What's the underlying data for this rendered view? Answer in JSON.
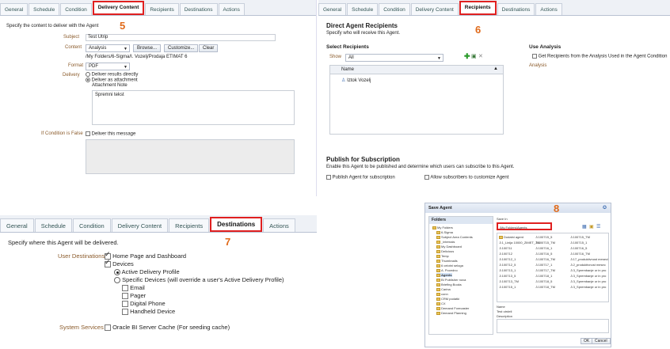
{
  "tabs": [
    "General",
    "Schedule",
    "Condition",
    "Delivery Content",
    "Recipients",
    "Destinations",
    "Actions"
  ],
  "steps": {
    "s5": "5",
    "s6": "6",
    "s7": "7",
    "s8": "8"
  },
  "delivery": {
    "intro": "Specify the content to deliver with the Agent",
    "subject_label": "Subject",
    "subject_value": "Test Utrip",
    "content_label": "Content",
    "content_value": "Analysis",
    "browse": "Browse...",
    "customize": "Customize...",
    "clear": "Clear",
    "path": "/My Folders/6-Sigma/I. Vozelj/Prodaja ETIMAT 6",
    "format_label": "Format",
    "format_value": "PDF",
    "delivery_label": "Delivery",
    "opt_direct": "Deliver results directly",
    "opt_attach": "Deliver as attachment",
    "note_label": "Attachment Note",
    "note_value": "Spremni tekst",
    "false_label": "If Condition is False",
    "false_value": "Deliver this message"
  },
  "recipients": {
    "title": "Direct Agent Recipients",
    "sub": "Specify who will receive this Agent.",
    "select_title": "Select Recipients",
    "show_label": "Show",
    "show_value": "All",
    "col_name": "Name",
    "recipient": "Iztok Vozelj",
    "use_title": "Use Analysis",
    "use_opt": "Get Recipients from the Analysis Used in the Agent Condition",
    "analysis": "Analysis",
    "pub_title": "Publish for Subscription",
    "pub_sub": "Enable this Agent to be published and determine which users can subscribe to this Agent.",
    "pub_opt": "Publish Agent for subscription",
    "allow_opt": "Allow subscribers to customize Agent"
  },
  "destinations": {
    "intro": "Specify where this Agent will be delivered.",
    "user_label": "User Destinations",
    "home": "Home Page and Dashboard",
    "devices": "Devices",
    "active": "Active Delivery Profile",
    "specific": "Specific Devices (will override a user's Active Delivery Profile)",
    "email": "Email",
    "pager": "Pager",
    "phone": "Digital Phone",
    "handheld": "Handheld Device",
    "system_label": "System Services",
    "cache": "Oracle BI Server Cache (For seeding cache)"
  },
  "save": {
    "title": "Save Agent",
    "folders": "Folders",
    "save_in": "Save In",
    "path": "/My Folders/Agents",
    "tree": [
      "6-Sigma",
      "Subject Area Contents",
      "_internals",
      "My Dashboard",
      "Delicious",
      "Temp",
      "Thumbnails",
      "6 celotni seloga",
      "A. Pocedno",
      "Agents",
      "BI Publisher nova",
      "Briefing Books",
      "Carina",
      "conn",
      "CRM podatki",
      "CX",
      "Demand Forecaster",
      "Demand Planning"
    ],
    "list1": [
      "Dodatni agent",
      "1_Linija 10000_ZIMET_TM",
      "100711",
      "100712",
      "100712_1",
      "100712_5",
      "100713_1",
      "100713_5",
      "100713_TM",
      "100715_1"
    ],
    "list2": [
      "100715_5",
      "100715_TM",
      "100716_1",
      "100716_5",
      "100716_TM",
      "100717_1",
      "100717_TM",
      "100718_1",
      "100718_5",
      "100718_TM"
    ],
    "list3": [
      "100715_TM",
      "100715_1",
      "100716_5",
      "100716_TM",
      "17_produktivnost meseci",
      "2_produktivnost mesec",
      "3_Sprembanje ur in pro",
      "3_Sprembanje ur in pro",
      "3_Sprembanje ur in pro",
      "3_Sprembanje ur in pro"
    ],
    "name_label": "Name",
    "name_value": "Test utrdeli",
    "desc_label": "Description",
    "ok": "OK",
    "cancel": "Cancel",
    "my_folders": "My Folders"
  }
}
